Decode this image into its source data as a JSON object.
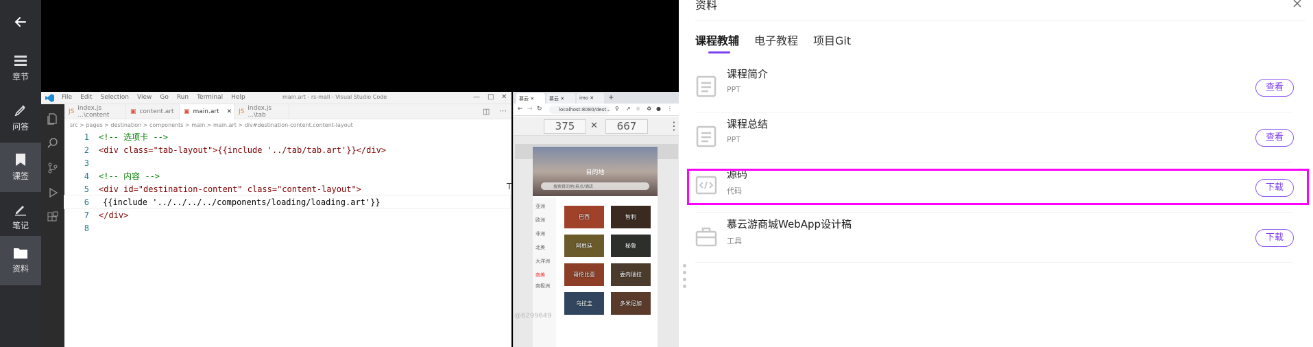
{
  "rail": {
    "items": [
      {
        "label": "章节",
        "icon": "chapters-icon"
      },
      {
        "label": "问答",
        "icon": "qa-icon"
      },
      {
        "label": "课签",
        "icon": "bookmark-icon"
      },
      {
        "label": "笔记",
        "icon": "notes-icon"
      },
      {
        "label": "资料",
        "icon": "folder-icon"
      }
    ]
  },
  "vscode": {
    "menu": [
      "File",
      "Edit",
      "Selection",
      "View",
      "Go",
      "Run",
      "Terminal",
      "Help"
    ],
    "window_title": "main.art - rs-mall - Visual Studio Code",
    "tabs": [
      "index.js ...\\content",
      "content.art",
      "main.art",
      "index.js ...\\tab"
    ],
    "breadcrumb": "src > pages > destination > components > main > main.art > div#destination-content.content-layout",
    "lines": [
      {
        "n": "1",
        "text": "<!-- 选项卡 -->"
      },
      {
        "n": "2",
        "text": "<div class=\"tab-layout\">{{include '../tab/tab.art'}}</div>"
      },
      {
        "n": "3",
        "text": ""
      },
      {
        "n": "4",
        "text": "<!-- 内容 -->"
      },
      {
        "n": "5",
        "text": "<div id=\"destination-content\" class=\"content-layout\">"
      },
      {
        "n": "6",
        "text": "{{include '../../../../components/loading/loading.art'}}"
      },
      {
        "n": "7",
        "text": "</div>"
      },
      {
        "n": "8",
        "text": ""
      }
    ]
  },
  "browser": {
    "tabs": [
      "慕云",
      "慕云",
      "imo"
    ],
    "url": "localhost:8080/dest...",
    "width": "375",
    "times": "✕",
    "height": "667",
    "hero_title": "目的地",
    "search_placeholder": "搜索目的地/景点/酒店",
    "side": [
      "亚洲",
      "欧洲",
      "非洲",
      "北美",
      "大洋洲",
      "南美",
      "南极洲"
    ],
    "cells": [
      "巴西",
      "智利",
      "阿根廷",
      "秘鲁",
      "哥伦比亚",
      "委内瑞拉",
      "乌拉圭",
      "多米尼加"
    ],
    "watermark": "@6299649"
  },
  "panel": {
    "title": "资料",
    "tabs": [
      "课程教辅",
      "电子教程",
      "项目Git"
    ],
    "rows": [
      {
        "title": "课程简介",
        "sub": "PPT",
        "action": "查看",
        "icon": "document-icon"
      },
      {
        "title": "课程总结",
        "sub": "PPT",
        "action": "查看",
        "icon": "document-icon"
      },
      {
        "title": "源码",
        "sub": "代码",
        "action": "下载",
        "icon": "code-icon"
      },
      {
        "title": "慕云游商城WebApp设计稿",
        "sub": "工具",
        "action": "下载",
        "icon": "toolbox-icon"
      }
    ],
    "accent": "#7b3ff2",
    "highlight": "#ff00ff"
  }
}
